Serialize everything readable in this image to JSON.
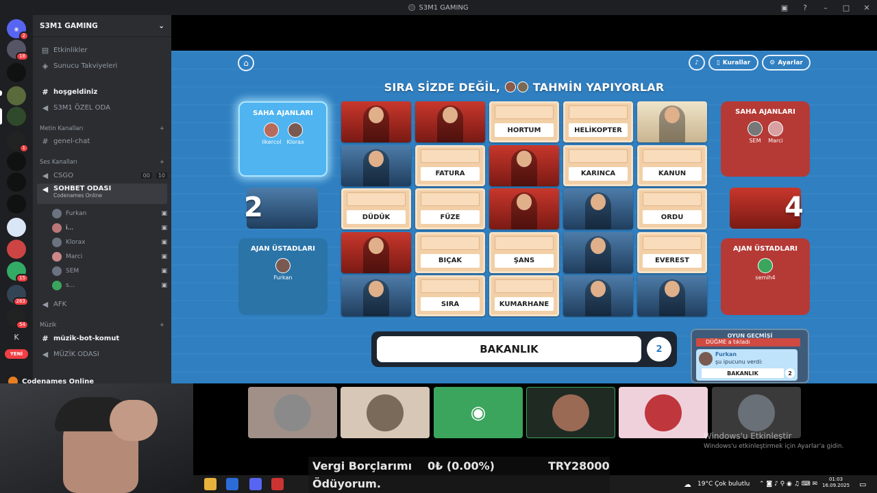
{
  "window": {
    "title": "S3M1 GAMING"
  },
  "server": {
    "name": "S3M1 GAMING",
    "top_items": [
      {
        "label": "Etkinlikler"
      },
      {
        "label": "Sunucu Takviyeleri"
      }
    ],
    "channels_top": [
      {
        "label": "hoşgeldiniz"
      },
      {
        "label": "S3M1 ÖZEL ODA"
      }
    ],
    "text_category": "Metin Kanalları",
    "text_channels": [
      {
        "label": "genel-chat"
      }
    ],
    "voice_category": "Ses Kanalları",
    "voice_csgo": "CSGO",
    "voice_csgo_count_a": "00",
    "voice_csgo_count_b": "10",
    "voice_active": "SOHBET ODASI",
    "voice_activity": "Codenames Online",
    "voice_users": [
      {
        "name": "Furkan"
      },
      {
        "name": "i..."
      },
      {
        "name": "Klorax"
      },
      {
        "name": "Marci"
      },
      {
        "name": "SEM"
      },
      {
        "name": "s..."
      }
    ],
    "afk": "AFK",
    "music_category": "Müzik",
    "music_channels": [
      {
        "label": "müzik-bot-komut"
      },
      {
        "label": "MÜZİK ODASI"
      }
    ],
    "activity_bar": "Codenames Online"
  },
  "guild_badges": {
    "b1": "2",
    "b2": "18",
    "b3": "1",
    "b4": "15",
    "b5": "263",
    "b6": "54",
    "new": "YENİ",
    "k": "K"
  },
  "game": {
    "kurallar": "Kurallar",
    "ayarlar": "Ayarlar",
    "turn_prefix": "SIRA SİZDE DEĞİL,",
    "turn_suffix": "TAHMİN YAPIYORLAR",
    "blue": {
      "field_title": "SAHA AJANLARI",
      "field_members": [
        "ilkercol",
        "Klorax"
      ],
      "score": "2",
      "master_title": "AJAN ÜSTADLARI",
      "master_members": [
        "Furkan"
      ]
    },
    "red": {
      "field_title": "SAHA AJANLARI",
      "field_members": [
        "SEM",
        "Marci"
      ],
      "score": "4",
      "master_title": "AJAN ÜSTADLARI",
      "master_members": [
        "semih4"
      ]
    },
    "board": [
      [
        "red",
        "red",
        "HORTUM",
        "HELİKOPTER",
        "neutral"
      ],
      [
        "blue",
        "FATURA",
        "red",
        "KARINCA",
        "KANUN"
      ],
      [
        "DÜDÜK",
        "FÜZE",
        "red",
        "blue",
        "ORDU"
      ],
      [
        "red",
        "BIÇAK",
        "ŞANS",
        "blue",
        "EVEREST"
      ],
      [
        "blue",
        "SIRA",
        "KUMARHANE",
        "blue",
        "blue"
      ]
    ],
    "clue_word": "BAKANLIK",
    "clue_count": "2",
    "history": {
      "title": "OYUN GEÇMİŞİ",
      "entry1": "DÜĞME a tıkladı",
      "user": "Furkan",
      "text": "şu ipucunu verdi:",
      "clue": "BAKANLIK",
      "count": "2"
    }
  },
  "overlay": {
    "label1": "Vergi Borçlarımı",
    "label2": "Ödüyorum.",
    "value": "0₺ (0.00%)",
    "target": "TRY28000"
  },
  "watermark": {
    "title": "Windows'u Etkinleştir",
    "sub": "Windows'u etkinleştirmek için Ayarlar'a gidin."
  },
  "taskbar": {
    "weather": "19°C  Çok bulutlu",
    "time": "01:03",
    "date": "16.09.2025"
  },
  "colors": {
    "discord_bg": "#2b2d31",
    "game_blue": "#2f7fc1",
    "red_team": "#b53a36",
    "blue_team": "#3da0e0"
  }
}
